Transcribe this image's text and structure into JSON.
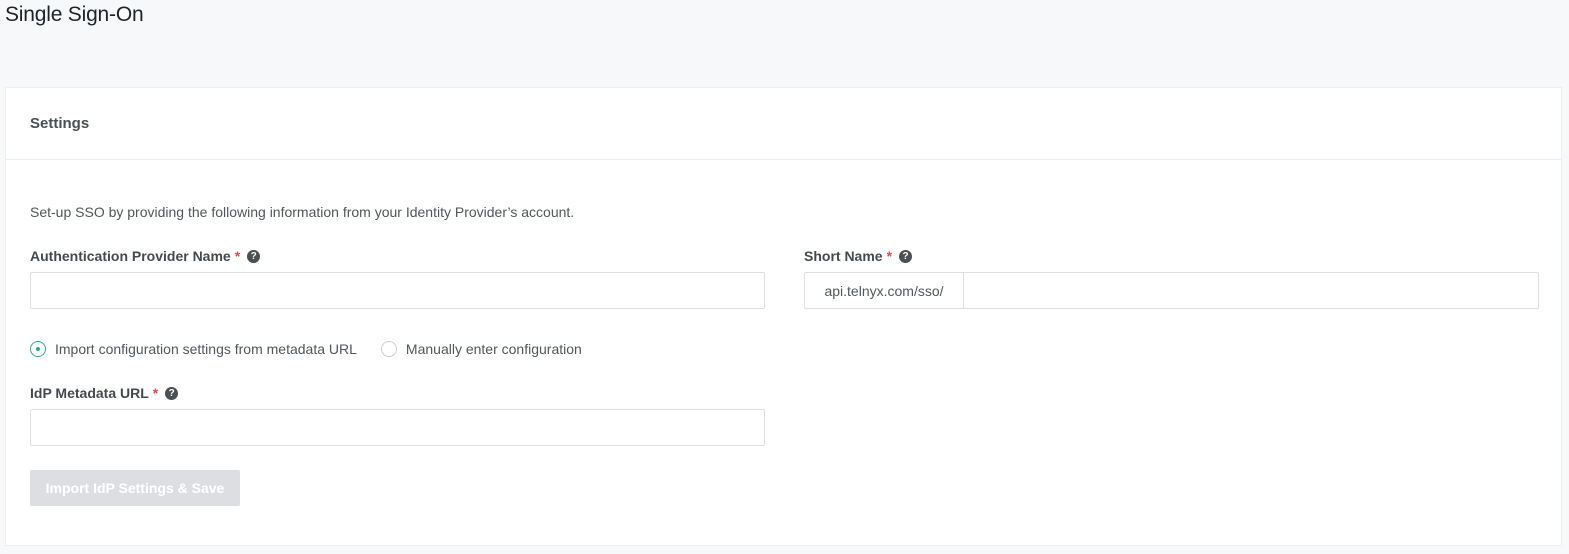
{
  "page": {
    "title": "Single Sign-On"
  },
  "settings": {
    "title": "Settings",
    "intro": "Set-up SSO by providing the following information from your Identity Provider’s account.",
    "provider_name": {
      "label": "Authentication Provider Name",
      "required_mark": "*",
      "help_icon": "question-circle-icon",
      "value": "",
      "placeholder": ""
    },
    "short_name": {
      "label": "Short Name",
      "required_mark": "*",
      "help_icon": "question-circle-icon",
      "prefix": "api.telnyx.com/sso/",
      "value": "",
      "placeholder": ""
    },
    "config_mode": {
      "options": [
        {
          "label": "Import configuration settings from metadata URL",
          "selected": true
        },
        {
          "label": "Manually enter configuration",
          "selected": false
        }
      ]
    },
    "metadata_url": {
      "label": "IdP Metadata URL",
      "required_mark": "*",
      "help_icon": "question-circle-icon",
      "value": "",
      "placeholder": ""
    },
    "submit": {
      "label": "Import IdP Settings & Save",
      "disabled": true
    }
  },
  "colors": {
    "page_background": "#f7f8fa",
    "card_background": "#ffffff",
    "required": "#e0494e",
    "radio_accent": "#26b07d",
    "disabled_button": "#dcdee2"
  }
}
